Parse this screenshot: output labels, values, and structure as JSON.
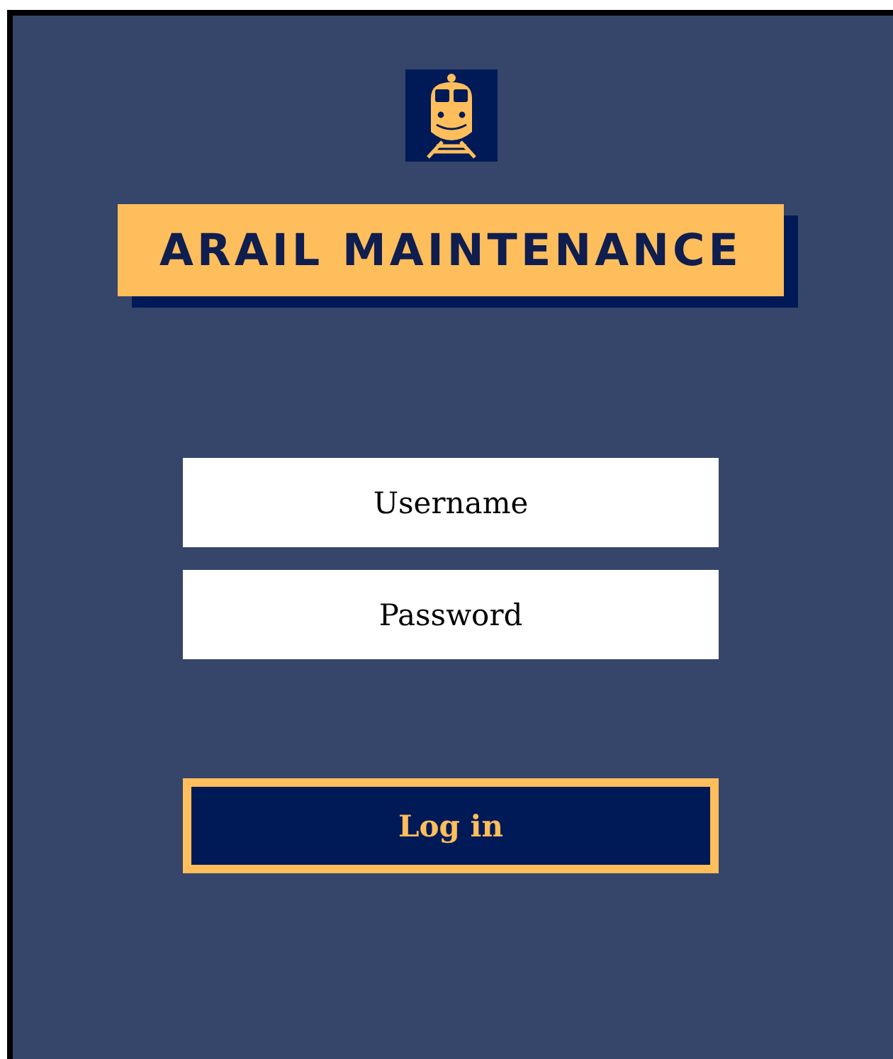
{
  "app": {
    "title": "ARAIL MAINTENANCE"
  },
  "login_form": {
    "fields": [
      {
        "placeholder": "Username"
      },
      {
        "placeholder": "Password"
      }
    ],
    "submit": {
      "label": "Log in"
    }
  }
}
